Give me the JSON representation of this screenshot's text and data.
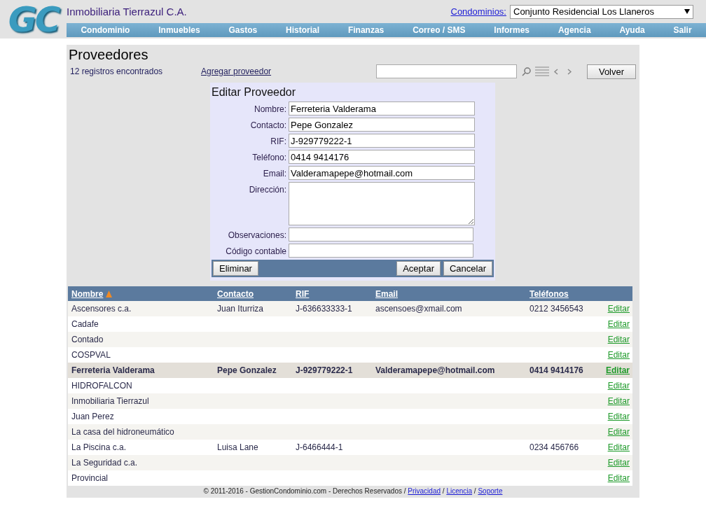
{
  "header": {
    "logo": "GC",
    "company": "Inmobiliaria Tierrazul C.A.",
    "condo_label": "Condominios:",
    "condo_value": "Conjunto Residencial Los Llaneros"
  },
  "nav": [
    "Condominio",
    "Inmuebles",
    "Gastos",
    "Historial",
    "Finanzas",
    "Correo / SMS",
    "Informes",
    "Agencia",
    "Ayuda",
    "Salir"
  ],
  "page": {
    "title": "Proveedores",
    "count": "12 registros encontrados",
    "add_link": "Agregar proveedor",
    "back_button": "Volver"
  },
  "form": {
    "title": "Editar Proveedor",
    "fields": [
      {
        "label": "Nombre:",
        "value": "Ferreteria Valderama",
        "kind": "input"
      },
      {
        "label": "Contacto:",
        "value": "Pepe Gonzalez",
        "kind": "input"
      },
      {
        "label": "RIF:",
        "value": "J-929779222-1",
        "kind": "input"
      },
      {
        "label": "Teléfono:",
        "value": "0414 9414176",
        "kind": "input"
      },
      {
        "label": "Email:",
        "value": "Valderamapepe@hotmail.com",
        "kind": "input"
      },
      {
        "label": "Dirección:",
        "kind": "textarea"
      },
      {
        "label": "Observaciones:",
        "kind": "input"
      },
      {
        "label": "Código contable",
        "kind": "input"
      }
    ],
    "delete_button": "Eliminar",
    "accept_button": "Aceptar",
    "cancel_button": "Cancelar"
  },
  "table": {
    "columns": [
      {
        "label": "Nombre",
        "sorted": true
      },
      {
        "label": "Contacto",
        "sorted": false
      },
      {
        "label": "RIF",
        "sorted": false
      },
      {
        "label": "Email",
        "sorted": false
      },
      {
        "label": "Teléfonos",
        "sorted": false
      }
    ],
    "rows": [
      {
        "cells": [
          "Ascensores c.a.",
          "Juan Iturriza",
          "J-636633333-1",
          "ascensoes@xmail.com",
          "0212 3456543"
        ],
        "action": "Editar",
        "selected": false
      },
      {
        "cells": [
          "Cadafe",
          "",
          "",
          "",
          ""
        ],
        "action": "Editar",
        "selected": false
      },
      {
        "cells": [
          "Contado",
          "",
          "",
          "",
          ""
        ],
        "action": "Editar",
        "selected": false
      },
      {
        "cells": [
          "COSPVAL",
          "",
          "",
          "",
          ""
        ],
        "action": "Editar",
        "selected": false
      },
      {
        "cells": [
          "Ferreteria Valderama",
          "Pepe Gonzalez",
          "J-929779222-1",
          "Valderamapepe@hotmail.com",
          "0414 9414176"
        ],
        "action": "Editar",
        "selected": true
      },
      {
        "cells": [
          "HIDROFALCON",
          "",
          "",
          "",
          ""
        ],
        "action": "Editar",
        "selected": false
      },
      {
        "cells": [
          "Inmobiliaria Tierrazul",
          "",
          "",
          "",
          ""
        ],
        "action": "Editar",
        "selected": false
      },
      {
        "cells": [
          "Juan Perez",
          "",
          "",
          "",
          ""
        ],
        "action": "Editar",
        "selected": false
      },
      {
        "cells": [
          "La casa del hidroneumático",
          "",
          "",
          "",
          ""
        ],
        "action": "Editar",
        "selected": false
      },
      {
        "cells": [
          "La Piscina c.a.",
          "Luisa Lane",
          "J-6466444-1",
          "",
          "0234 456766"
        ],
        "action": "Editar",
        "selected": false
      },
      {
        "cells": [
          "La Seguridad c.a.",
          "",
          "",
          "",
          ""
        ],
        "action": "Editar",
        "selected": false
      },
      {
        "cells": [
          "Provincial",
          "",
          "",
          "",
          ""
        ],
        "action": "Editar",
        "selected": false
      }
    ]
  },
  "footer": [
    {
      "kind": "text",
      "text": "© 2011-2016 - GestionCondominio.com - Derechos Reservados /"
    },
    {
      "kind": "link",
      "text": "Privacidad"
    },
    {
      "kind": "text",
      "text": "/"
    },
    {
      "kind": "link",
      "text": "Licencia"
    },
    {
      "kind": "text",
      "text": "/"
    },
    {
      "kind": "link",
      "text": "Soporte"
    }
  ]
}
